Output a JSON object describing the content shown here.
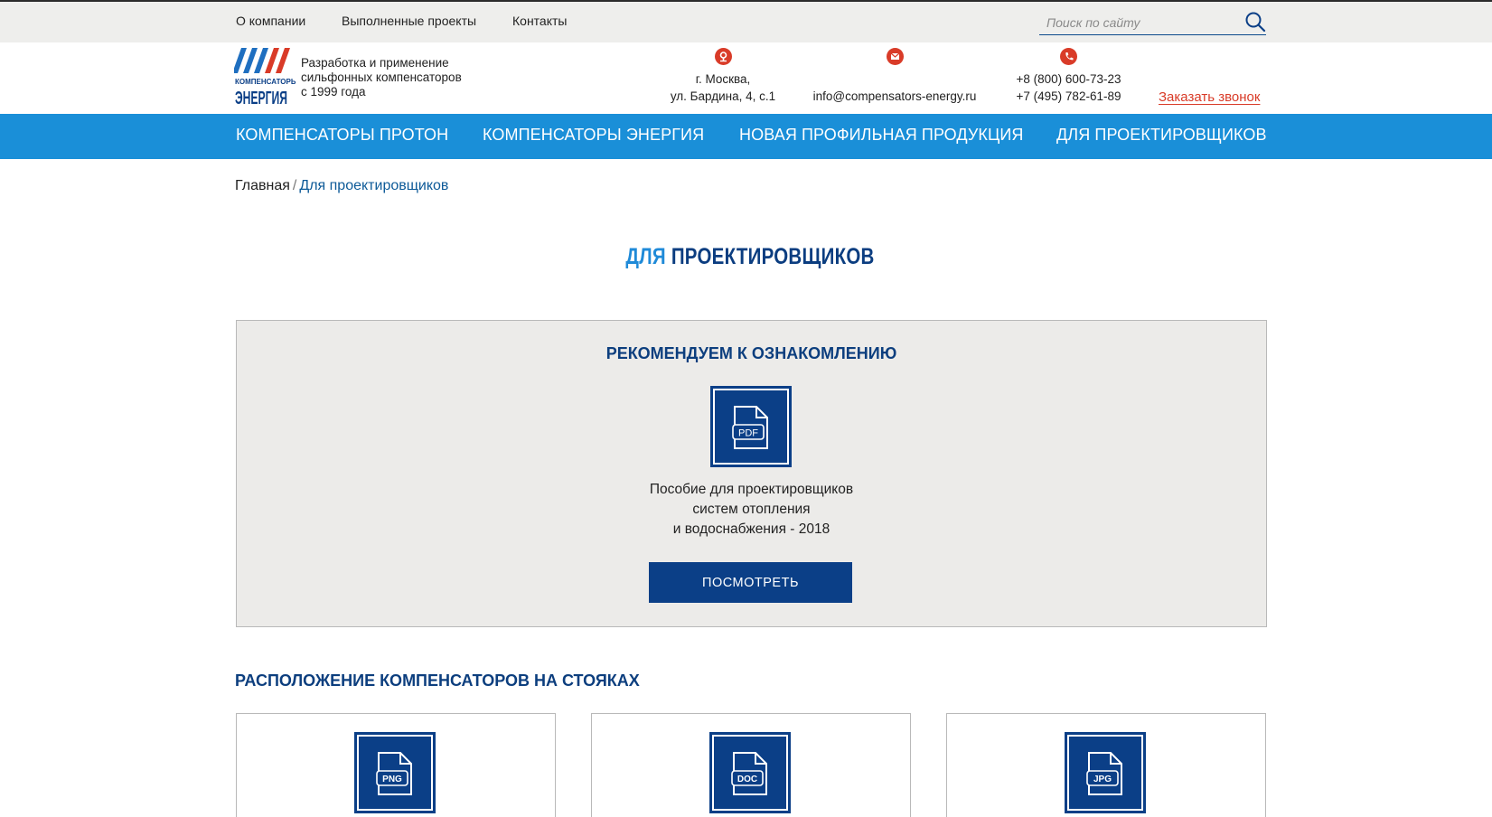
{
  "topnav": {
    "items": [
      {
        "label": "О компании"
      },
      {
        "label": "Выполненные проекты"
      },
      {
        "label": "Контакты"
      }
    ]
  },
  "search": {
    "placeholder": "Поиск по сайту",
    "icon": "search-icon"
  },
  "brand": {
    "logo_text_small": "КОМПЕНСАТОРЫ",
    "logo_text_large": "ЭНЕРГИЯ",
    "tagline_lines": [
      "Разработка и применение",
      "сильфонных компенсаторов",
      "с 1999 года"
    ]
  },
  "contacts": {
    "address": {
      "icon": "location-pin-icon",
      "lines": [
        "г. Москва,",
        "ул. Бардина, 4, с.1"
      ]
    },
    "email": {
      "icon": "mail-icon",
      "value": "info@compensators-energy.ru"
    },
    "phones": {
      "icon": "phone-icon",
      "lines": [
        "+8 (800) 600-73-23",
        "+7 (495) 782-61-89"
      ]
    },
    "callback_label": "Заказать звонок"
  },
  "mainnav": {
    "items": [
      {
        "label": "КОМПЕНСАТОРЫ ПРОТОН"
      },
      {
        "label": "КОМПЕНСАТОРЫ ЭНЕРГИЯ"
      },
      {
        "label": "НОВАЯ ПРОФИЛЬНАЯ ПРОДУКЦИЯ"
      },
      {
        "label": "ДЛЯ ПРОЕКТИРОВЩИКОВ"
      }
    ]
  },
  "breadcrumb": {
    "home": "Главная",
    "separator": "/",
    "current": "Для проектировщиков"
  },
  "page_title": {
    "part1": "ДЛЯ",
    "part2": "ПРОЕКТИРОВЩИКОВ"
  },
  "recommended": {
    "title": "РЕКОМЕНДУЕМ К ОЗНАКОМЛЕНИЮ",
    "file_type": "PDF",
    "description_lines": [
      "Пособие для проектировщиков",
      "систем отопления",
      "и водоснабжения - 2018"
    ],
    "button_label": "ПОСМОТРЕТЬ"
  },
  "placement": {
    "title": "РАСПОЛОЖЕНИЕ КОМПЕНСАТОРОВ НА СТОЯКАХ",
    "cards": [
      {
        "file_type": "PNG",
        "icon": "png-file-icon"
      },
      {
        "file_type": "DOC",
        "icon": "doc-file-icon"
      },
      {
        "file_type": "JPG",
        "icon": "jpg-file-icon"
      }
    ]
  },
  "colors": {
    "accent_blue": "#1a8fd8",
    "dark_blue": "#0b3f87",
    "red": "#d93b28",
    "topbar_bg": "#eeeeec",
    "box_bg": "#ecebe9"
  }
}
